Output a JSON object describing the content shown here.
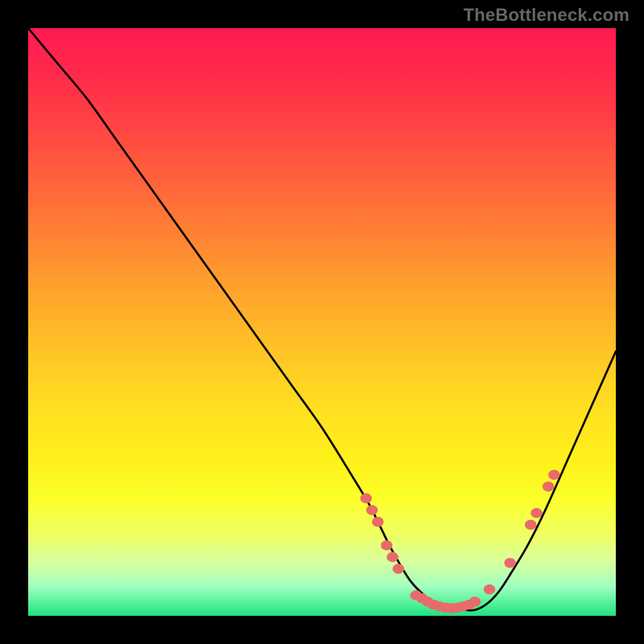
{
  "watermark": "TheBottleneck.com",
  "chart_data": {
    "type": "line",
    "title": "",
    "xlabel": "",
    "ylabel": "",
    "xlim": [
      0,
      100
    ],
    "ylim": [
      0,
      100
    ],
    "series": [
      {
        "name": "bottleneck-curve",
        "x": [
          0,
          5,
          10,
          15,
          20,
          25,
          30,
          35,
          40,
          45,
          50,
          55,
          58,
          60,
          62,
          65,
          68,
          70,
          72,
          74,
          76,
          78,
          80,
          82,
          85,
          88,
          92,
          96,
          100
        ],
        "y": [
          100,
          94,
          88,
          81,
          74,
          67,
          60,
          53,
          46,
          39,
          32,
          24,
          19,
          15,
          11,
          6,
          3,
          2,
          1,
          1,
          1,
          2,
          4,
          7,
          12,
          18,
          27,
          36,
          45
        ]
      }
    ],
    "markers": [
      {
        "x": 57.5,
        "y": 20
      },
      {
        "x": 58.5,
        "y": 18
      },
      {
        "x": 59.5,
        "y": 16
      },
      {
        "x": 61.0,
        "y": 12
      },
      {
        "x": 62.0,
        "y": 10
      },
      {
        "x": 63.0,
        "y": 8
      },
      {
        "x": 66.0,
        "y": 3.5
      },
      {
        "x": 67.0,
        "y": 3.0
      },
      {
        "x": 68.0,
        "y": 2.4
      },
      {
        "x": 69.0,
        "y": 1.9
      },
      {
        "x": 70.0,
        "y": 1.6
      },
      {
        "x": 71.0,
        "y": 1.4
      },
      {
        "x": 72.0,
        "y": 1.3
      },
      {
        "x": 73.0,
        "y": 1.4
      },
      {
        "x": 74.0,
        "y": 1.6
      },
      {
        "x": 75.0,
        "y": 1.9
      },
      {
        "x": 76.0,
        "y": 2.4
      },
      {
        "x": 78.5,
        "y": 4.5
      },
      {
        "x": 82.0,
        "y": 9.0
      },
      {
        "x": 85.5,
        "y": 15.5
      },
      {
        "x": 86.5,
        "y": 17.5
      },
      {
        "x": 88.5,
        "y": 22.0
      },
      {
        "x": 89.5,
        "y": 24.0
      }
    ],
    "marker_color": "#e96a6a",
    "curve_color": "#000000"
  }
}
